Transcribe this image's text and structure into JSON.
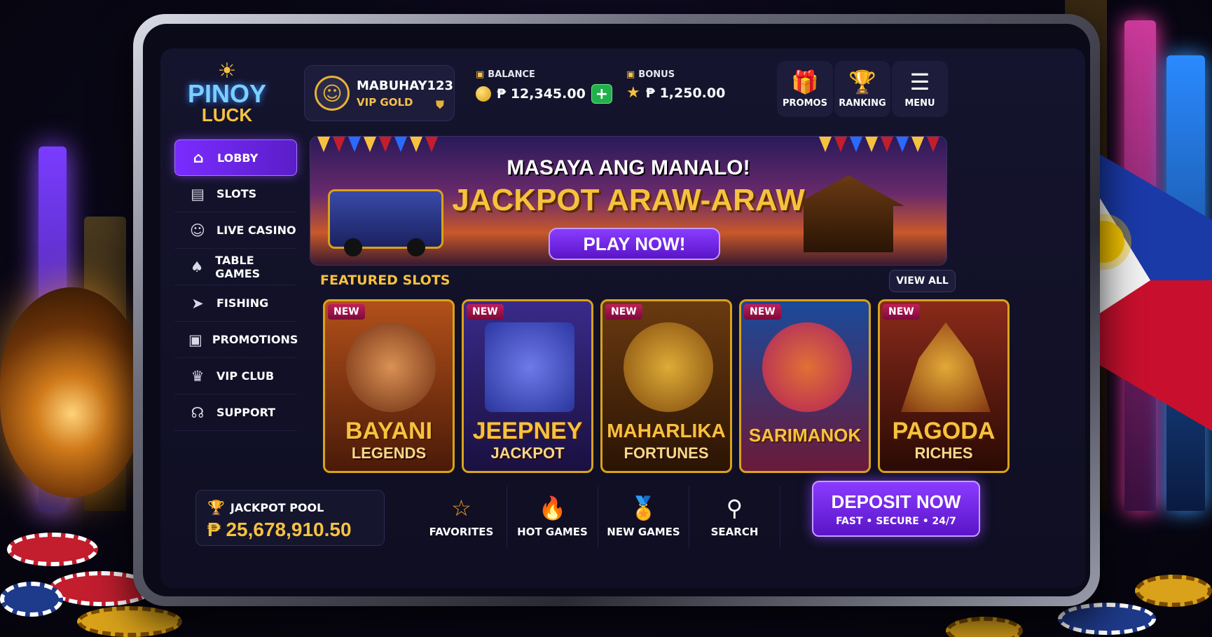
{
  "brand": {
    "logo_top": "PINOY",
    "logo_bottom": "LUCK"
  },
  "user": {
    "name": "MABUHAY123",
    "tier": "VIP GOLD"
  },
  "balance": {
    "label": "BALANCE",
    "value": "₱ 12,345.00",
    "add_label": "+"
  },
  "bonus": {
    "label": "BONUS",
    "value": "₱ 1,250.00"
  },
  "top_actions": [
    {
      "label": "PROMOS",
      "icon": "gift-icon",
      "glyph": "🎁"
    },
    {
      "label": "RANKING",
      "icon": "trophy-icon",
      "glyph": "🏆"
    },
    {
      "label": "MENU",
      "icon": "hamburger-menu-icon",
      "glyph": "☰"
    }
  ],
  "sidebar": {
    "items": [
      {
        "label": "LOBBY",
        "icon": "home-icon",
        "glyph": "⌂",
        "active": true
      },
      {
        "label": "SLOTS",
        "icon": "slot-machine-icon",
        "glyph": "▤"
      },
      {
        "label": "LIVE CASINO",
        "icon": "dealer-icon",
        "glyph": "☺"
      },
      {
        "label": "TABLE GAMES",
        "icon": "spade-icon",
        "glyph": "♠"
      },
      {
        "label": "FISHING",
        "icon": "fish-icon",
        "glyph": "➤"
      },
      {
        "label": "PROMOTIONS",
        "icon": "gift-icon",
        "glyph": "▣"
      },
      {
        "label": "VIP CLUB",
        "icon": "crown-icon",
        "glyph": "♛"
      },
      {
        "label": "SUPPORT",
        "icon": "headset-icon",
        "glyph": "☊"
      }
    ]
  },
  "banner": {
    "subtitle": "MASAYA ANG MANALO!",
    "title": "JACKPOT ARAW-ARAW",
    "cta": "PLAY NOW!"
  },
  "featured": {
    "title": "FEATURED SLOTS",
    "view_all": "VIEW ALL",
    "badge": "NEW",
    "games": [
      {
        "line1": "BAYANI",
        "line2": "LEGENDS"
      },
      {
        "line1": "JEEPNEY",
        "line2": "JACKPOT"
      },
      {
        "line1": "MAHARLIKA",
        "line2": "FORTUNES"
      },
      {
        "line1": "SARIMANOK",
        "line2": ""
      },
      {
        "line1": "PAGODA",
        "line2": "RICHES"
      }
    ]
  },
  "jackpot": {
    "label": "JACKPOT POOL",
    "value": "₱ 25,678,910.50"
  },
  "bottom_nav": [
    {
      "label": "FAVORITES",
      "icon": "star-icon",
      "glyph": "☆"
    },
    {
      "label": "HOT GAMES",
      "icon": "flame-icon",
      "glyph": "🔥"
    },
    {
      "label": "NEW GAMES",
      "icon": "ribbon-badge-icon",
      "glyph": "🏅"
    },
    {
      "label": "SEARCH",
      "icon": "search-icon",
      "glyph": "⚲"
    }
  ],
  "deposit": {
    "label": "DEPOSIT NOW",
    "sub": "FAST • SECURE • 24/7"
  },
  "colors": {
    "accent_purple": "#7a2cff",
    "gold": "#f6c23e",
    "background": "#0f0e22",
    "add_green": "#22b04a"
  }
}
